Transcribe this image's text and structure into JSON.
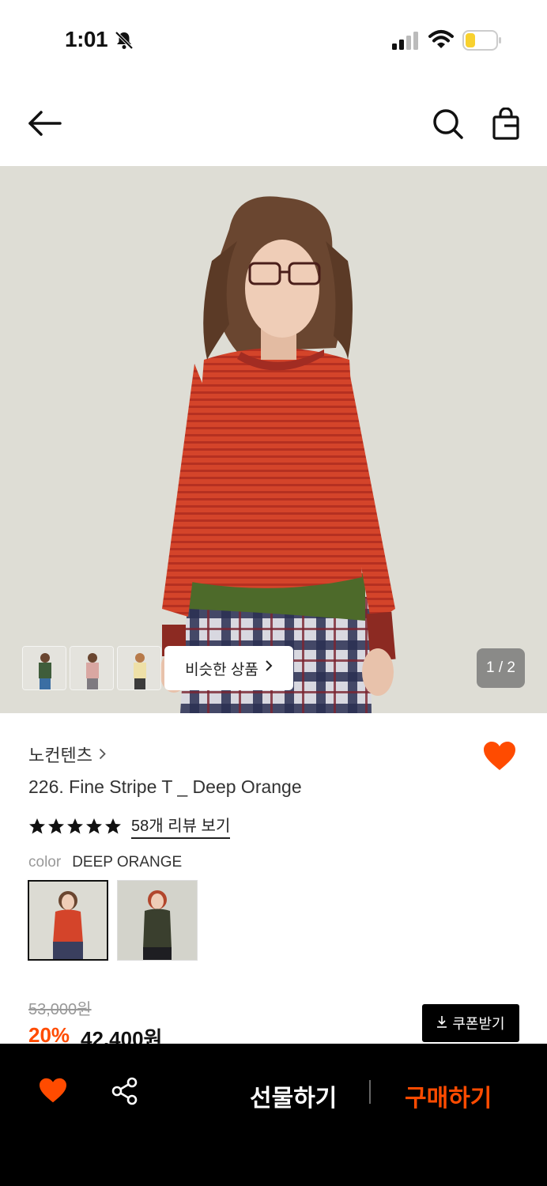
{
  "status_bar": {
    "time": "1:01"
  },
  "gallery": {
    "similar_label": "비슷한 상품",
    "pager": "1 / 2"
  },
  "product": {
    "brand": "노컨텐츠",
    "name": "226. Fine Stripe T _ Deep Orange",
    "rating_stars": 5,
    "reviews_link": "58개 리뷰 보기",
    "color_label": "color",
    "color_value": "DEEP ORANGE",
    "original_price": "53,000원",
    "discount": "20%",
    "sale_price": "42,400원",
    "coupon_label": "쿠폰받기"
  },
  "bottom_bar": {
    "gift_label": "선물하기",
    "buy_label": "구매하기"
  },
  "colors": {
    "accent": "#ff4b00",
    "bar_bg": "#000000"
  }
}
